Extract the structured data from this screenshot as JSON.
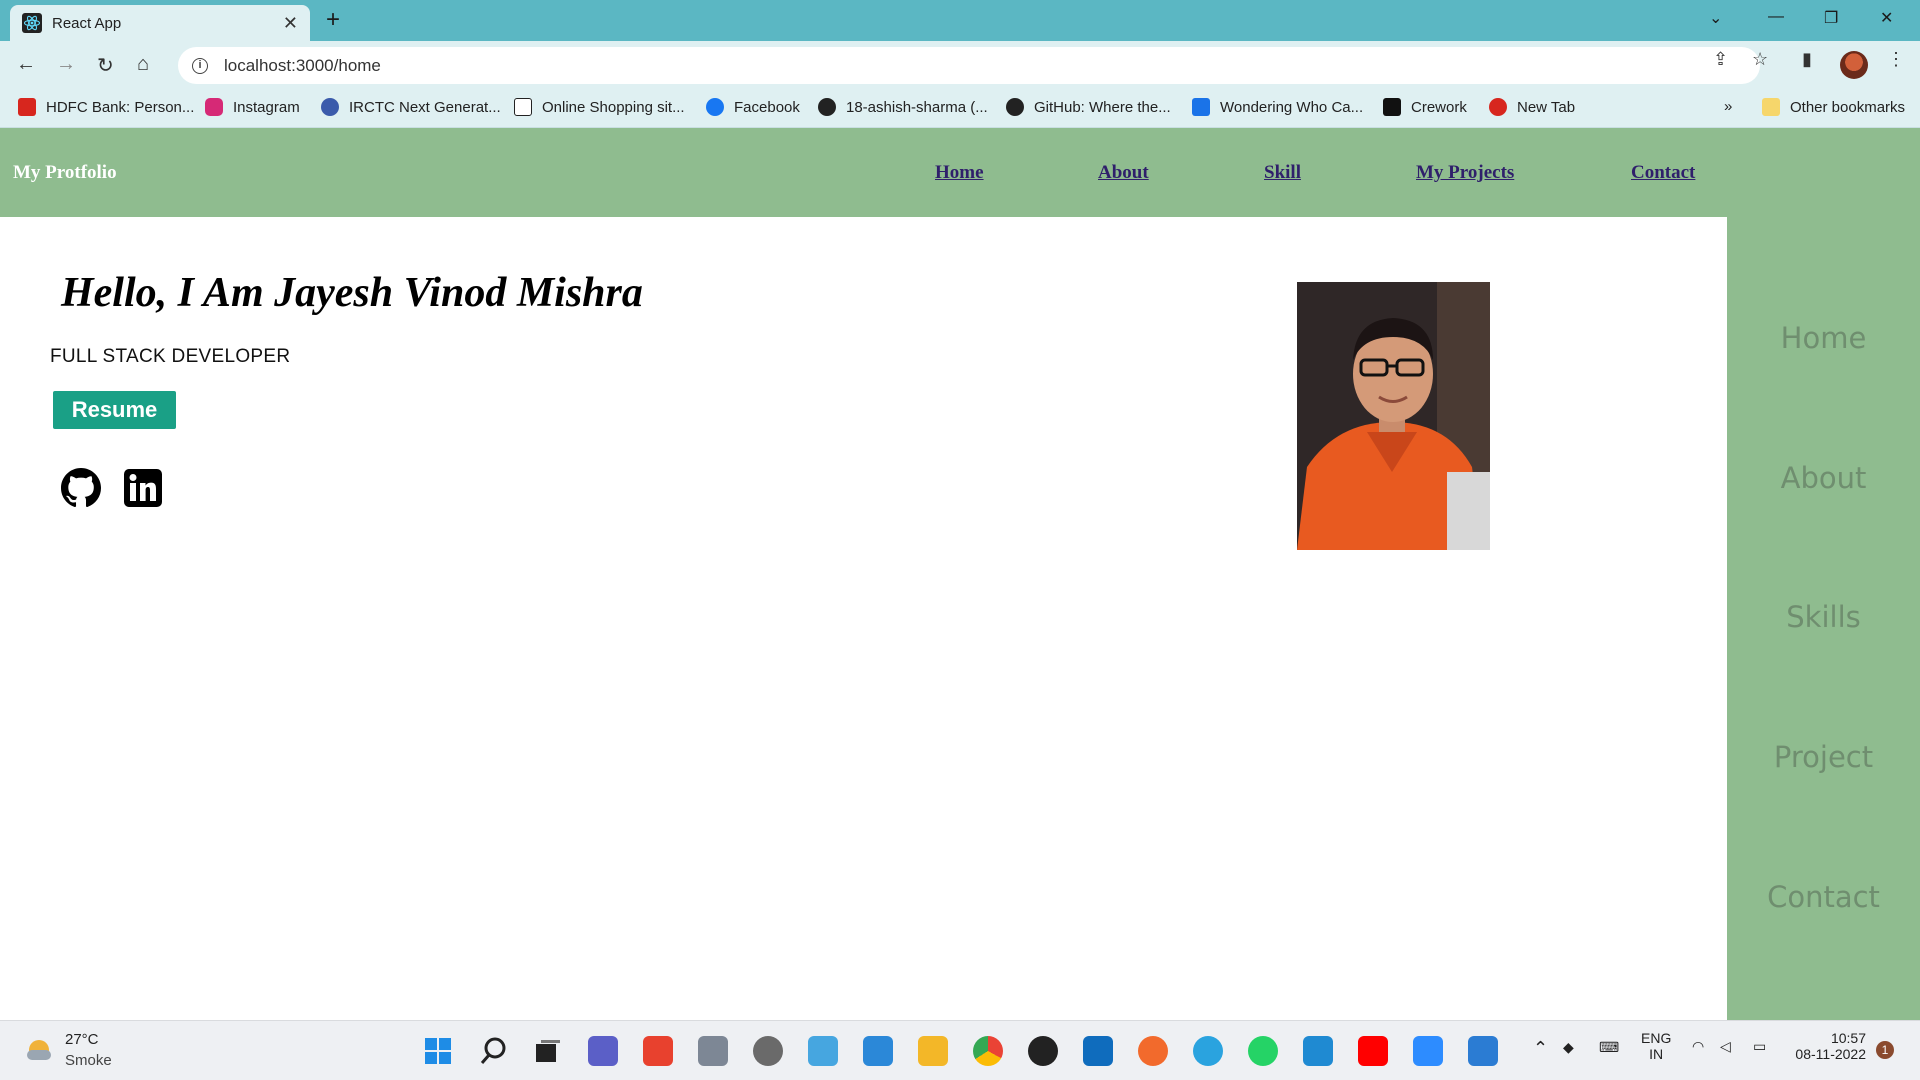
{
  "browser": {
    "tab_title": "React App",
    "url": "localhost:3000/home",
    "bookmarks": [
      {
        "label": "HDFC Bank: Person...",
        "color": "#d7261e"
      },
      {
        "label": "Instagram",
        "color": "#d62976"
      },
      {
        "label": "IRCTC Next Generat...",
        "color": "#3b5bab"
      },
      {
        "label": "Online Shopping sit...",
        "color": "#222222"
      },
      {
        "label": "Facebook",
        "color": "#1877f2"
      },
      {
        "label": "18-ashish-sharma (...",
        "color": "#222222"
      },
      {
        "label": "GitHub: Where the...",
        "color": "#222222"
      },
      {
        "label": "Wondering Who Ca...",
        "color": "#1a73e8"
      },
      {
        "label": "Crework",
        "color": "#111111"
      },
      {
        "label": "New Tab",
        "color": "#d7261e"
      }
    ],
    "more_bookmarks": "»",
    "other_bookmarks": "Other bookmarks"
  },
  "site": {
    "brand": "My Protfolio",
    "nav": [
      "Home",
      "About",
      "Skill",
      "My Projects",
      "Contact"
    ],
    "sidebar": [
      "Home",
      "About",
      "Skills",
      "Project",
      "Contact"
    ],
    "greeting": "Hello, I Am Jayesh Vinod Mishra",
    "role": "FULL STACK DEVELOPER",
    "resume_label": "Resume",
    "colors": {
      "navbar": "#8fbc8f",
      "button": "#1aa086",
      "nav_link": "#2f1f6b"
    }
  },
  "taskbar": {
    "temp": "27°C",
    "weather": "Smoke",
    "lang_line1": "ENG",
    "lang_line2": "IN",
    "time": "10:57",
    "date": "08-11-2022",
    "notifications": "1"
  }
}
